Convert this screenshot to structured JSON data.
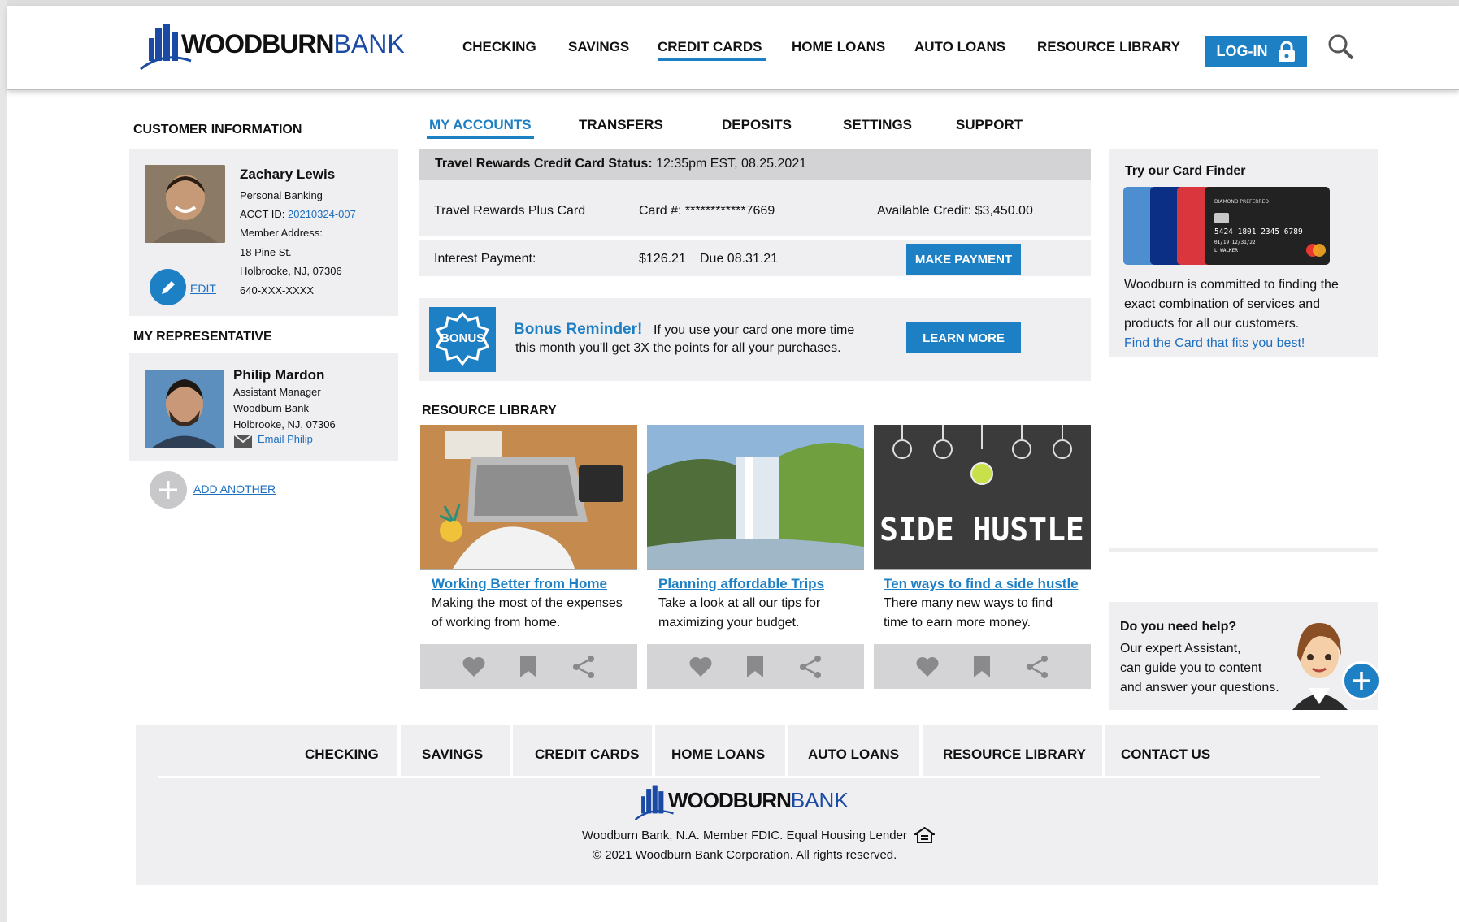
{
  "brand": {
    "wood": "WOODBURN",
    "bank": "BANK",
    "primary": "#1d7fc4",
    "dark_blue": "#1a4aa3"
  },
  "nav": {
    "items": [
      "CHECKING",
      "SAVINGS",
      "CREDIT CARDS",
      "HOME LOANS",
      "AUTO LOANS",
      "RESOURCE LIBRARY"
    ],
    "active": "CREDIT CARDS",
    "login": "LOG-IN"
  },
  "customer": {
    "section_title": "CUSTOMER INFORMATION",
    "name": "Zachary Lewis",
    "type": "Personal Banking",
    "acct_label": "ACCT ID:",
    "acct_id": "20210324-007",
    "addr_label": "Member Address:",
    "street": "18 Pine St.",
    "city": "Holbrooke, NJ, 07306",
    "phone": "640-XXX-XXXX",
    "edit": "EDIT"
  },
  "representative": {
    "section_title": "MY REPRESENTATIVE",
    "name": "Philip Mardon",
    "title": "Assistant Manager",
    "org": "Woodburn Bank",
    "city": "Holbrooke, NJ, 07306",
    "email": "Email Philip",
    "add_another": "ADD ANOTHER"
  },
  "tabs": [
    "MY ACCOUNTS",
    "TRANSFERS",
    "DEPOSITS",
    "SETTINGS",
    "SUPPORT"
  ],
  "status": {
    "label": "Travel Rewards Credit Card Status:",
    "time": "12:35pm EST, 08.25.2021",
    "card_name": "Travel Rewards Plus Card",
    "card_number": "Card #: ************7669",
    "available": "Available Credit: $3,450.00",
    "interest_label": "Interest Payment:",
    "interest_amount": "$126.21",
    "due": "Due 08.31.21",
    "make_payment": "MAKE PAYMENT"
  },
  "bonus": {
    "badge": "BONUS",
    "title": "Bonus Reminder!",
    "text1": "If you use your card one more time",
    "text2": "this month you'll get 3X the points for all your purchases.",
    "button": "LEARN MORE"
  },
  "library": {
    "title": "RESOURCE LIBRARY",
    "cards": [
      {
        "title": "Working Better from Home",
        "line1": "Making the most of the expenses",
        "line2": "of working from home."
      },
      {
        "title": "Planning affordable Trips",
        "line1": "Take a look at all our tips for",
        "line2": "maximizing your budget."
      },
      {
        "title": "Ten ways to find a side hustle",
        "line1": "There many new ways to find",
        "line2": "time to earn more money.",
        "image_text": "SIDE HUSTLE"
      }
    ]
  },
  "card_finder": {
    "title": "Try our Card Finder",
    "text1": "Woodburn is committed to finding the",
    "text2": "exact combination of services and",
    "text3": "products for all our customers.",
    "link": "Find the Card that fits you best!",
    "card_number": "5424 1801 2345 6789",
    "card_dates": "01/19 12/31/22",
    "card_holder": "L WALKER",
    "card_brand": "DIAMOND PREFERRED"
  },
  "help": {
    "title": "Do you need help?",
    "line1": "Our expert Assistant,",
    "line2": "can guide you to content",
    "line3": "and answer your questions."
  },
  "footer": {
    "links": [
      "CHECKING",
      "SAVINGS",
      "CREDIT CARDS",
      "HOME LOANS",
      "AUTO LOANS",
      "RESOURCE LIBRARY",
      "CONTACT US"
    ],
    "line1": "Woodburn Bank, N.A. Member FDIC. Equal Housing Lender",
    "line2": "© 2021 Woodburn Bank Corporation. All rights reserved."
  }
}
